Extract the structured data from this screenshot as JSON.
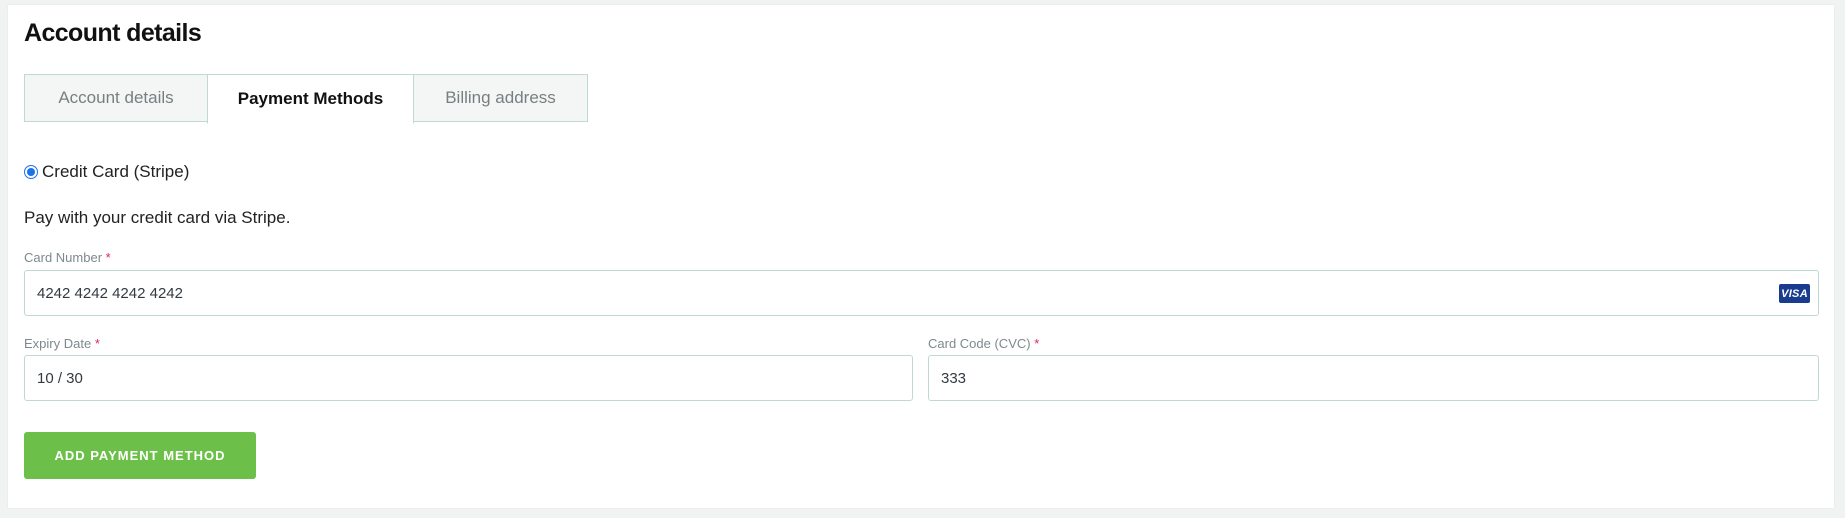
{
  "page": {
    "title": "Account details"
  },
  "tabs": [
    {
      "label": "Account details",
      "active": false
    },
    {
      "label": "Payment Methods",
      "active": true
    },
    {
      "label": "Billing address",
      "active": false
    }
  ],
  "payment_method": {
    "label": "Credit Card (Stripe)",
    "selected": true,
    "description": "Pay with your credit card via Stripe."
  },
  "form": {
    "card_number": {
      "label": "Card Number",
      "required_mark": "*",
      "value": "4242 4242 4242 4242",
      "brand": "VISA"
    },
    "expiry": {
      "label": "Expiry Date",
      "required_mark": "*",
      "value": "10 / 30"
    },
    "cvc": {
      "label": "Card Code (CVC)",
      "required_mark": "*",
      "value": "333"
    }
  },
  "actions": {
    "submit_label": "ADD PAYMENT METHOD"
  },
  "colors": {
    "accent_button": "#6cc04a",
    "tab_border": "#bfd9d3",
    "radio": "#1a73e8",
    "required": "#e0245e",
    "visa_badge": "#1a3c8f"
  }
}
